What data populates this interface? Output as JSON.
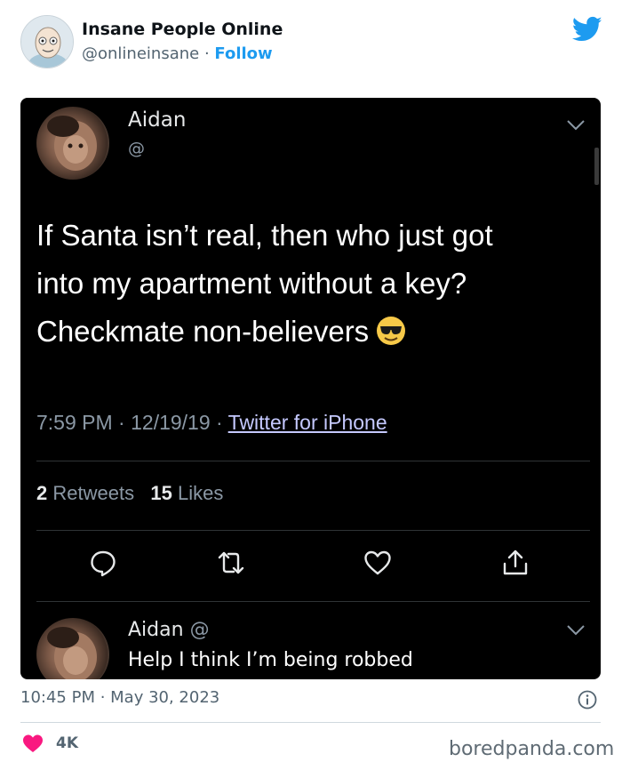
{
  "embed": {
    "account_name": "Insane People Online",
    "account_handle": "@onlineinsane",
    "separator": " · ",
    "follow_label": "Follow",
    "brand_icon": "twitter-bird-icon",
    "brand_color": "#1d9bf0"
  },
  "screenshot": {
    "author_name": "Aidan",
    "author_handle": "@",
    "text_lines": [
      "If Santa isn’t real, then who just got",
      "into my apartment without a key?",
      "Checkmate non-believers"
    ],
    "emoji": "smiling-face-with-sunglasses",
    "time": "7:59 PM",
    "date": "12/19/19",
    "dot": " · ",
    "source": "Twitter for iPhone",
    "retweets_count": "2",
    "retweets_label": " Retweets",
    "likes_count": "15",
    "likes_label": " Likes",
    "actions": [
      "reply-icon",
      "retweet-icon",
      "like-icon",
      "share-icon"
    ],
    "reply": {
      "author_name": "Aidan",
      "author_handle": "@",
      "text": "Help I think I’m being robbed"
    }
  },
  "footer": {
    "post_date": "10:45 PM · May 30, 2023",
    "like_count": "4K",
    "heart_color": "#f91880",
    "watermark": "boredpanda.com"
  }
}
